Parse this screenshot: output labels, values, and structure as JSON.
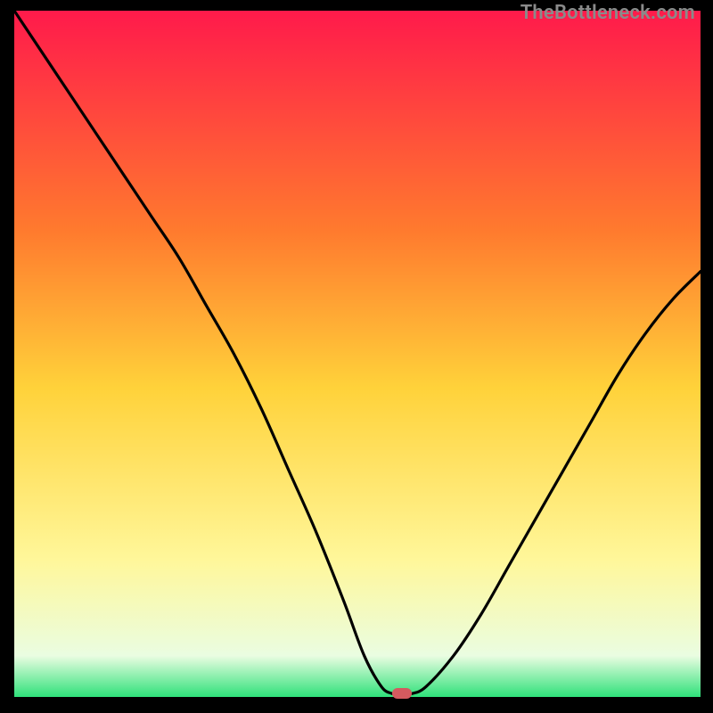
{
  "watermark": {
    "text": "TheBottleneck.com"
  },
  "colors": {
    "gradient_top": "#ff1a4b",
    "gradient_mid_upper": "#ff7a2e",
    "gradient_mid": "#ffd23a",
    "gradient_mid_lower": "#fff79a",
    "gradient_base_pale": "#eafde1",
    "gradient_base": "#2fe17a",
    "line": "#000000",
    "marker": "#d45a5f",
    "frame": "#000000"
  },
  "chart_data": {
    "type": "line",
    "title": "",
    "xlabel": "",
    "ylabel": "",
    "xlim": [
      0,
      100
    ],
    "ylim": [
      0,
      100
    ],
    "grid": false,
    "legend": false,
    "series": [
      {
        "name": "left_branch",
        "x": [
          0,
          4,
          8,
          12,
          16,
          20,
          24,
          28,
          32,
          36,
          40,
          44,
          48,
          51,
          53.5,
          55
        ],
        "values": [
          100,
          94,
          88,
          82,
          76,
          70,
          64,
          57,
          50,
          42,
          33,
          24,
          14,
          6,
          1.5,
          0.5
        ]
      },
      {
        "name": "right_branch",
        "x": [
          58,
          60,
          64,
          68,
          72,
          76,
          80,
          84,
          88,
          92,
          96,
          100
        ],
        "values": [
          0.5,
          1.5,
          6,
          12,
          19,
          26,
          33,
          40,
          47,
          53,
          58,
          62
        ]
      }
    ],
    "marker": {
      "x": 56.5,
      "y": 0.5,
      "shape": "pill"
    }
  }
}
